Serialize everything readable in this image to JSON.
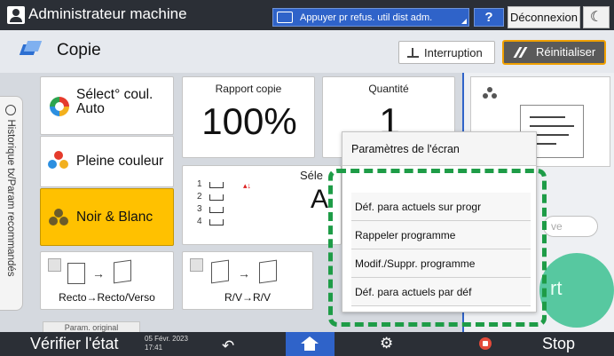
{
  "header": {
    "user_label": "Administrateur machine",
    "remote_button": "Appuyer pr refus. util dist adm.",
    "help_label": "?",
    "logout_label": "Déconnexion",
    "moon_glyph": "☾"
  },
  "title_row": {
    "app_title": "Copie",
    "interrupt_label": "Interruption",
    "reset_label": "Réinitialiser"
  },
  "history_tab": {
    "label": "Historique tx/Param recommandés"
  },
  "color_modes": {
    "auto_label": "Sélect° coul. Auto",
    "full_label": "Pleine couleur",
    "bw_label": "Noir & Blanc"
  },
  "ratio": {
    "label": "Rapport copie",
    "value": "100%"
  },
  "quantity": {
    "label": "Quantité",
    "value": "1"
  },
  "layout_fragment": {
    "select_text": "Séle",
    "size_text": "A"
  },
  "duplex": {
    "label": "Recto→Recto/Verso"
  },
  "rv": {
    "label": "R/V→R/V"
  },
  "original": {
    "label": "Param. original"
  },
  "popup": {
    "header": "Paramètres de l'écran",
    "items": [
      "Déf. para actuels sur progr",
      "Rappeler programme",
      "Modif./Suppr. programme",
      "Déf. para actuels par déf"
    ]
  },
  "preview": {
    "pill_text": "ve",
    "start_text": "rt"
  },
  "footer": {
    "verify_label": "Vérifier l'état",
    "date": "05 Févr. 2023",
    "time": "17:41",
    "stop_label": "Stop"
  },
  "colors": {
    "accent_blue": "#2f63c9",
    "bw_selected": "#ffc100",
    "highlight_dash": "#1e9c47",
    "reset_border": "#f0a000"
  }
}
